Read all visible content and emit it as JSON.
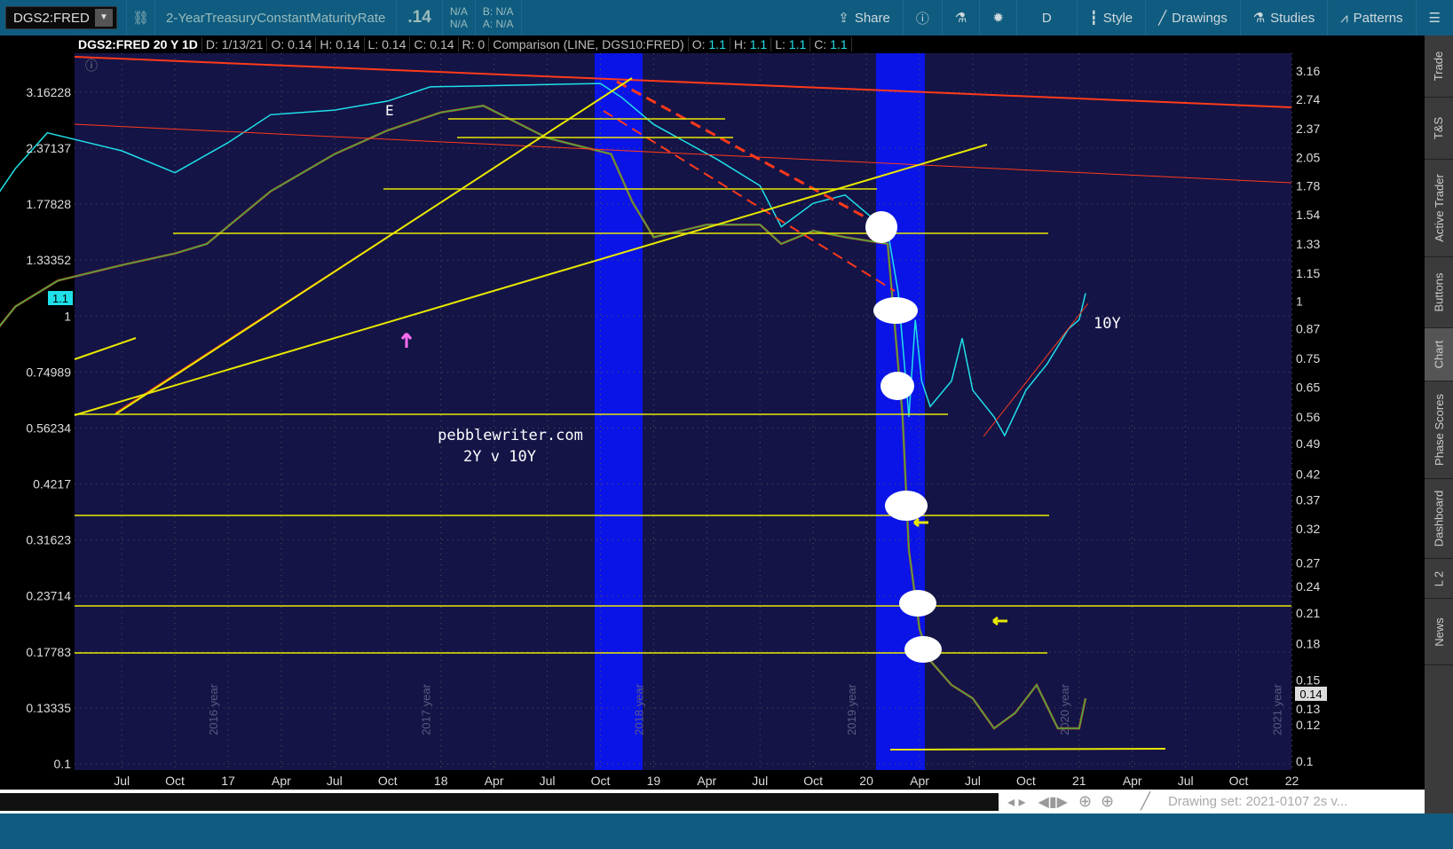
{
  "toolbar": {
    "symbol": "DGS2:FRED",
    "description": "2-YearTreasuryConstantMaturityRate",
    "last": ".14",
    "na1": "N/A",
    "na2": "N/A",
    "bid": "B: N/A",
    "ask": "A: N/A",
    "share": "Share",
    "period": "D",
    "style": "Style",
    "drawings": "Drawings",
    "studies": "Studies",
    "patterns": "Patterns"
  },
  "info": {
    "title": "DGS2:FRED 20 Y 1D",
    "date": "D: 1/13/21",
    "open": "O: 0.14",
    "high": "H: 0.14",
    "low": "L: 0.14",
    "close": "C: 0.14",
    "range": "R: 0",
    "comparison": "Comparison (LINE, DGS10:FRED)",
    "c_open_label": "O:",
    "c_open": "1.1",
    "c_high_label": "H:",
    "c_high": "1.1",
    "c_low_label": "L:",
    "c_low": "1.1",
    "c_close_label": "C:",
    "c_close": "1.1"
  },
  "side_tabs": [
    "Trade",
    "T&S",
    "Active Trader",
    "Buttons",
    "Chart",
    "Phase Scores",
    "Dashboard",
    "L 2",
    "News"
  ],
  "bottom": {
    "drawing_set": "Drawing set: 2021-0107 2s v..."
  },
  "colors": {
    "bg": "#141447",
    "series2y": "#3cb043",
    "series10y": "#1fe0e8",
    "band": "#0a14e6",
    "hline": "#e8e800",
    "trend": "#ff3a1a"
  },
  "annotations": {
    "e": "E",
    "site": "pebblewriter.com",
    "subtitle": "2Y v 10Y",
    "label10y": "10Y",
    "left_marker": "1.1",
    "right_marker": "0.14"
  },
  "chart_data": {
    "type": "line",
    "scale": "log",
    "left_axis_ticks": [
      "3.16228",
      "2.37137",
      "1.77828",
      "1.33352",
      "1",
      "0.74989",
      "0.56234",
      "0.4217",
      "0.31623",
      "0.23714",
      "0.17783",
      "0.13335",
      "0.1"
    ],
    "left_axis_values": [
      3.16228,
      2.37137,
      1.77828,
      1.33352,
      1,
      0.74989,
      0.56234,
      0.4217,
      0.31623,
      0.23714,
      0.17783,
      0.13335,
      0.1
    ],
    "right_axis_ticks": [
      "3.16",
      "2.74",
      "2.37",
      "2.05",
      "1.78",
      "1.54",
      "1.33",
      "1.15",
      "1",
      "0.87",
      "0.75",
      "0.65",
      "0.56",
      "0.49",
      "0.42",
      "0.37",
      "0.32",
      "0.27",
      "0.24",
      "0.21",
      "0.18",
      "0.15",
      "0.13",
      "0.12",
      "0.1"
    ],
    "x_ticks": [
      {
        "t": 2015.5,
        "label": "Jul"
      },
      {
        "t": 2015.75,
        "label": "Oct"
      },
      {
        "t": 2016,
        "label": "17"
      },
      {
        "t": 2016.25,
        "label": "Apr"
      },
      {
        "t": 2016.5,
        "label": "Jul"
      },
      {
        "t": 2016.75,
        "label": "Oct"
      },
      {
        "t": 2017,
        "label": "18"
      },
      {
        "t": 2017.25,
        "label": "Apr"
      },
      {
        "t": 2017.5,
        "label": "Jul"
      },
      {
        "t": 2017.75,
        "label": "Oct"
      },
      {
        "t": 2018,
        "label": "19"
      },
      {
        "t": 2018.25,
        "label": "Apr"
      },
      {
        "t": 2018.5,
        "label": "Jul"
      },
      {
        "t": 2018.75,
        "label": "Oct"
      },
      {
        "t": 2019,
        "label": "20"
      },
      {
        "t": 2019.25,
        "label": "Apr"
      },
      {
        "t": 2019.5,
        "label": "Jul"
      },
      {
        "t": 2019.75,
        "label": "Oct"
      },
      {
        "t": 2020,
        "label": "21"
      },
      {
        "t": 2020.25,
        "label": "Apr"
      },
      {
        "t": 2020.5,
        "label": "Jul"
      },
      {
        "t": 2020.75,
        "label": "Oct"
      },
      {
        "t": 2021,
        "label": "22"
      }
    ],
    "year_labels": [
      "2016 year",
      "2017 year",
      "2018 year",
      "2019 year",
      "2020 year",
      "2021 year"
    ],
    "series": [
      {
        "name": "DGS2:FRED",
        "axis": "left",
        "x": [
          2014.28,
          2014.4,
          2014.5,
          2014.6,
          2014.8,
          2015.0,
          2015.2,
          2015.5,
          2015.75,
          2015.9,
          2016.2,
          2016.5,
          2016.75,
          2017.0,
          2017.2,
          2017.5,
          2017.8,
          2017.9,
          2018.0,
          2018.25,
          2018.5,
          2018.6,
          2018.75,
          2018.9,
          2019.1,
          2019.17,
          2019.2,
          2019.25,
          2019.3,
          2019.4,
          2019.5,
          2019.6,
          2019.7,
          2019.8,
          2019.9,
          2020.0,
          2020.03
        ],
        "values": [
          0.75,
          0.9,
          0.6,
          0.7,
          0.8,
          1.05,
          1.2,
          1.3,
          1.38,
          1.45,
          1.9,
          2.3,
          2.6,
          2.85,
          2.95,
          2.5,
          2.3,
          1.8,
          1.5,
          1.6,
          1.6,
          1.45,
          1.55,
          1.5,
          1.45,
          0.6,
          0.3,
          0.2,
          0.17,
          0.15,
          0.14,
          0.12,
          0.13,
          0.15,
          0.12,
          0.12,
          0.14
        ]
      },
      {
        "name": "DGS10:FRED",
        "axis": "right",
        "x": [
          2014.28,
          2014.45,
          2014.8,
          2015.0,
          2015.15,
          2015.5,
          2015.75,
          2016.0,
          2016.2,
          2016.5,
          2016.75,
          2016.95,
          2017.75,
          2017.85,
          2018.0,
          2018.3,
          2018.5,
          2018.6,
          2018.75,
          2018.9,
          2019.1,
          2019.15,
          2019.2,
          2019.23,
          2019.26,
          2019.3,
          2019.4,
          2019.45,
          2019.5,
          2019.6,
          2019.65,
          2019.75,
          2019.85,
          2019.95,
          2020.0,
          2020.03
        ],
        "values": [
          1.66,
          1.3,
          1.42,
          1.94,
          2.32,
          2.12,
          1.9,
          2.21,
          2.54,
          2.6,
          2.72,
          2.92,
          2.97,
          2.77,
          2.42,
          2.03,
          1.78,
          1.45,
          1.63,
          1.7,
          1.42,
          1.04,
          0.56,
          0.91,
          0.67,
          0.59,
          0.67,
          0.83,
          0.64,
          0.56,
          0.51,
          0.64,
          0.73,
          0.87,
          0.91,
          1.04
        ]
      }
    ]
  }
}
